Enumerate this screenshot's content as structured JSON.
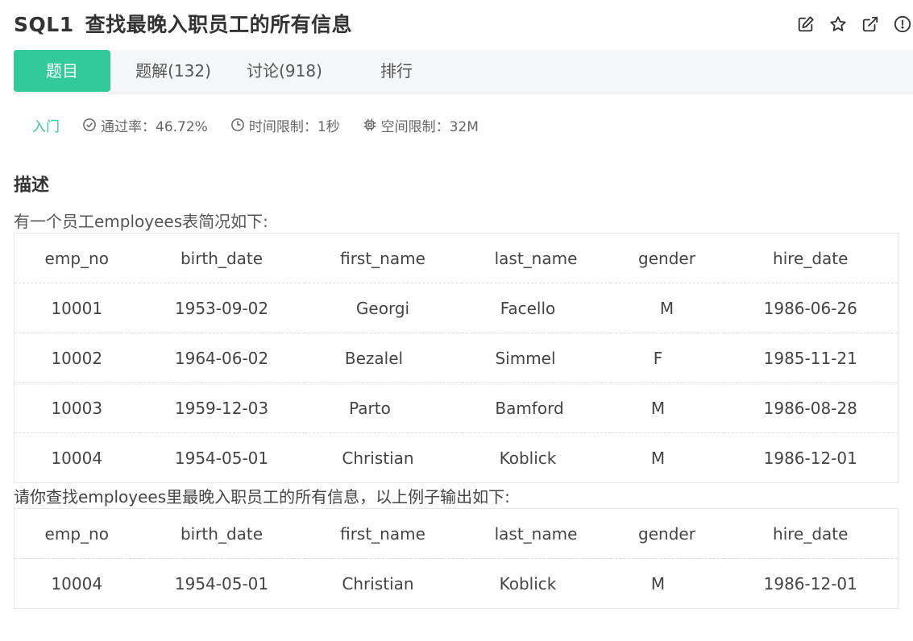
{
  "header": {
    "question_id": "SQL1",
    "title": "查找最晚入职员工的所有信息",
    "actions": [
      "edit-icon",
      "star-icon",
      "external-link-icon",
      "report-icon"
    ]
  },
  "tabs": [
    {
      "label": "题目",
      "active": true
    },
    {
      "label": "题解(132)",
      "active": false
    },
    {
      "label": "讨论(918)",
      "active": false
    },
    {
      "label": "排行",
      "active": false
    }
  ],
  "meta": {
    "level": "入门",
    "pass_rate": "通过率：46.72%",
    "time_limit": "时间限制：1秒",
    "space_limit": "空间限制：32M"
  },
  "description": {
    "heading": "描述",
    "intro": "有一个员工employees表简况如下:",
    "prompt": "请你查找employees里最晚入职员工的所有信息，以上例子输出如下:"
  },
  "table1": {
    "headers": [
      "emp_no",
      "birth_date",
      "first_name",
      "last_name",
      "gender",
      "hire_date"
    ],
    "rows": [
      [
        "10001",
        "1953-09-02",
        "Georgi",
        "Facello",
        "M",
        "1986-06-26"
      ],
      [
        "10002",
        "1964-06-02",
        "Bezalel",
        "Simmel",
        "F",
        "1985-11-21"
      ],
      [
        "10003",
        "1959-12-03",
        "Parto",
        "Bamford",
        "M",
        "1986-08-28"
      ],
      [
        "10004",
        "1954-05-01",
        "Christian",
        "Koblick",
        "M",
        "1986-12-01"
      ]
    ]
  },
  "table2": {
    "headers": [
      "emp_no",
      "birth_date",
      "first_name",
      "last_name",
      "gender",
      "hire_date"
    ],
    "rows": [
      [
        "10004",
        "1954-05-01",
        "Christian",
        "Koblick",
        "M",
        "1986-12-01"
      ]
    ]
  },
  "colors": {
    "accent": "#32ca99",
    "tab_bg": "#f5f6f7"
  }
}
